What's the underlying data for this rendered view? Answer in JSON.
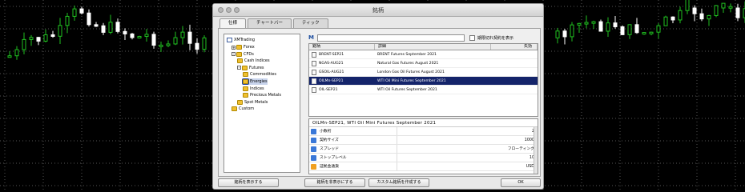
{
  "window": {
    "title": "銘柄"
  },
  "tabs": [
    {
      "label": "仕様"
    },
    {
      "label": "チャートバー"
    },
    {
      "label": "ティック"
    }
  ],
  "tree": {
    "root": "XMTrading",
    "items": [
      {
        "label": "Forex",
        "level": 1,
        "expander": "+"
      },
      {
        "label": "CFDs",
        "level": 1,
        "expander": "-"
      },
      {
        "label": "Cash Indices",
        "level": 2,
        "expander": ""
      },
      {
        "label": "Futures",
        "level": 2,
        "expander": "-"
      },
      {
        "label": "Commodities",
        "level": 3,
        "expander": ""
      },
      {
        "label": "Energies",
        "level": 3,
        "expander": "",
        "selected": true
      },
      {
        "label": "Indices",
        "level": 3,
        "expander": ""
      },
      {
        "label": "Precious Metals",
        "level": 3,
        "expander": ""
      },
      {
        "label": "Spot Metals",
        "level": 2,
        "expander": ""
      },
      {
        "label": "Custom",
        "level": 1,
        "expander": ""
      }
    ]
  },
  "search": {
    "value": "",
    "placeholder": ""
  },
  "expired_checkbox": {
    "label": "期限切れ契約を表示",
    "checked": false
  },
  "table": {
    "headers": {
      "symbol": "銘柄",
      "description": "詳細",
      "expiry": "失効"
    },
    "rows": [
      {
        "symbol": "BRENT-SEP21",
        "description": "BRENT Futures September 2021",
        "selected": false
      },
      {
        "symbol": "NGAS-AUG21",
        "description": "Natural Gas Futures August 2021",
        "selected": false
      },
      {
        "symbol": "GSOIL-AUG21",
        "description": "London Gas Oil Futures August 2021",
        "selected": false
      },
      {
        "symbol": "OILMn-SEP21",
        "description": "WTI Oil Mini Futures September 2021",
        "selected": true
      },
      {
        "symbol": "OIL-SEP21",
        "description": "WTI Oil Futures September 2021",
        "selected": false
      }
    ]
  },
  "detail": {
    "title": "OILMn-SEP21, WTI Oil Mini Futures September 2021",
    "properties": [
      {
        "name": "小数桁",
        "value": "2",
        "icon": "blue"
      },
      {
        "name": "契約サイズ",
        "value": "1000",
        "icon": "blue"
      },
      {
        "name": "スプレッド",
        "value": "フローティング",
        "icon": "blue"
      },
      {
        "name": "ストップレベル",
        "value": "10",
        "icon": "blue"
      },
      {
        "name": "証拠金通貨",
        "value": "USD",
        "icon": "orange"
      }
    ]
  },
  "buttons": {
    "show": "銘柄を表示する",
    "hide": "銘柄を非表示にする",
    "create_custom": "カスタム銘柄を作成する",
    "ok": "OK"
  },
  "colors": {
    "selected_row": "#14246a",
    "chart_bull": "#20c020",
    "chart_bear": "#ffffff",
    "chart_bg": "#000000"
  }
}
